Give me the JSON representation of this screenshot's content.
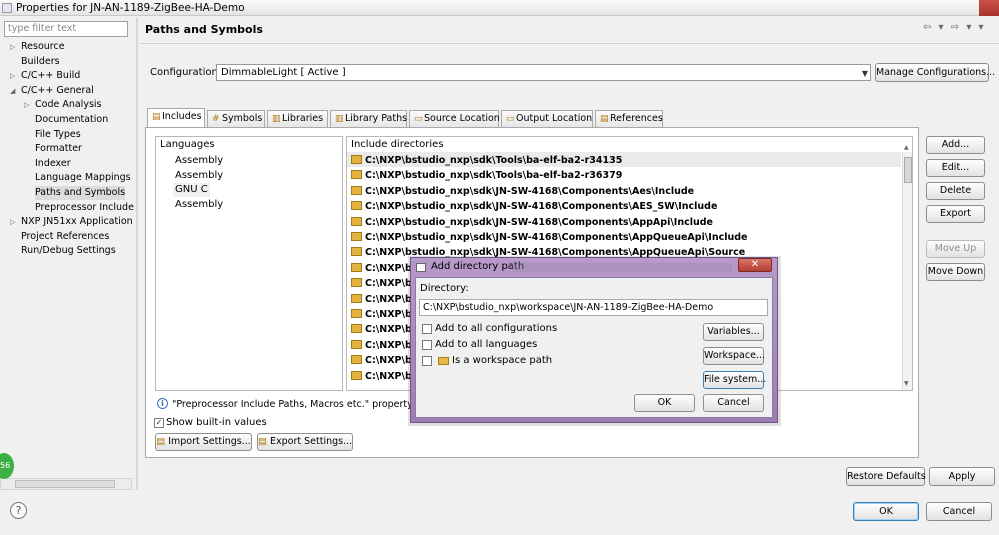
{
  "window": {
    "title": "Properties for JN-AN-1189-ZigBee-HA-Demo"
  },
  "left": {
    "filter_placeholder": "type filter text",
    "tree": [
      {
        "label": "Resource",
        "twisty": "▷"
      },
      {
        "label": "Builders",
        "twisty": ""
      },
      {
        "label": "C/C++ Build",
        "twisty": "▷"
      },
      {
        "label": "C/C++ General",
        "twisty": "◢"
      },
      {
        "label": "Code Analysis",
        "twisty": "▷"
      },
      {
        "label": "Documentation",
        "twisty": ""
      },
      {
        "label": "File Types",
        "twisty": ""
      },
      {
        "label": "Formatter",
        "twisty": ""
      },
      {
        "label": "Indexer",
        "twisty": ""
      },
      {
        "label": "Language Mappings",
        "twisty": ""
      },
      {
        "label": "Paths and Symbols",
        "twisty": ""
      },
      {
        "label": "Preprocessor Include",
        "twisty": ""
      },
      {
        "label": "NXP JN51xx Application",
        "twisty": "▷"
      },
      {
        "label": "Project References",
        "twisty": ""
      },
      {
        "label": "Run/Debug Settings",
        "twisty": ""
      }
    ],
    "badge": "56"
  },
  "header": {
    "title": "Paths and Symbols",
    "nav_icons": "⇦ ▾ ⇨ ▾ ▾"
  },
  "config": {
    "label": "Configuration:",
    "value": "DimmableLight  [ Active ]",
    "manage_label": "Manage Configurations..."
  },
  "tabs": [
    {
      "label": "Includes",
      "icon": "▤"
    },
    {
      "label": "Symbols",
      "icon": "#"
    },
    {
      "label": "Libraries",
      "icon": "▥"
    },
    {
      "label": "Library Paths",
      "icon": "▥"
    },
    {
      "label": "Source Location",
      "icon": "▭"
    },
    {
      "label": "Output Location",
      "icon": "▭"
    },
    {
      "label": "References",
      "icon": "▤"
    }
  ],
  "languages": {
    "header": "Languages",
    "items": [
      "Assembly",
      "Assembly",
      "GNU C",
      "Assembly"
    ]
  },
  "includes": {
    "header": "Include directories",
    "rows": [
      "C:\\NXP\\bstudio_nxp\\sdk\\Tools\\ba-elf-ba2-r34135",
      "C:\\NXP\\bstudio_nxp\\sdk\\Tools\\ba-elf-ba2-r36379",
      "C:\\NXP\\bstudio_nxp\\sdk\\JN-SW-4168\\Components\\Aes\\Include",
      "C:\\NXP\\bstudio_nxp\\sdk\\JN-SW-4168\\Components\\AES_SW\\Include",
      "C:\\NXP\\bstudio_nxp\\sdk\\JN-SW-4168\\Components\\AppApi\\Include",
      "C:\\NXP\\bstudio_nxp\\sdk\\JN-SW-4168\\Components\\AppQueueApi\\Include",
      "C:\\NXP\\bstudio_nxp\\sdk\\JN-SW-4168\\Components\\AppQueueApi\\Source",
      "C:\\NXP\\bs",
      "C:\\NXP\\bs",
      "C:\\NXP\\bs",
      "C:\\NXP\\bs",
      "C:\\NXP\\bs",
      "C:\\NXP\\bs",
      "C:\\NXP\\bs",
      "C:\\NXP\\bs",
      "C:\\NXP\\bs"
    ]
  },
  "side_buttons": {
    "add": "Add...",
    "edit": "Edit...",
    "delete": "Delete",
    "export": "Export",
    "move_up": "Move Up",
    "move_down": "Move Down"
  },
  "info_text": "\"Preprocessor Include Paths, Macros etc.\" property pag",
  "show_builtin": {
    "label": "Show built-in values",
    "checked": true
  },
  "bottom": {
    "import_label": "Import Settings...",
    "export_label": "Export Settings...",
    "restore_label": "Restore Defaults",
    "apply_label": "Apply",
    "ok_label": "OK",
    "cancel_label": "Cancel",
    "help": "?"
  },
  "dialog": {
    "title": "Add directory path",
    "close": "✕",
    "directory_label": "Directory:",
    "directory_value": "C:\\NXP\\bstudio_nxp\\workspace\\JN-AN-1189-ZigBee-HA-Demo",
    "add_all_configs": "Add to all configurations",
    "add_all_langs": "Add to all languages",
    "workspace_path": "Is a workspace path",
    "variables": "Variables...",
    "workspace": "Workspace...",
    "file_system": "File system...",
    "ok": "OK",
    "cancel": "Cancel"
  }
}
